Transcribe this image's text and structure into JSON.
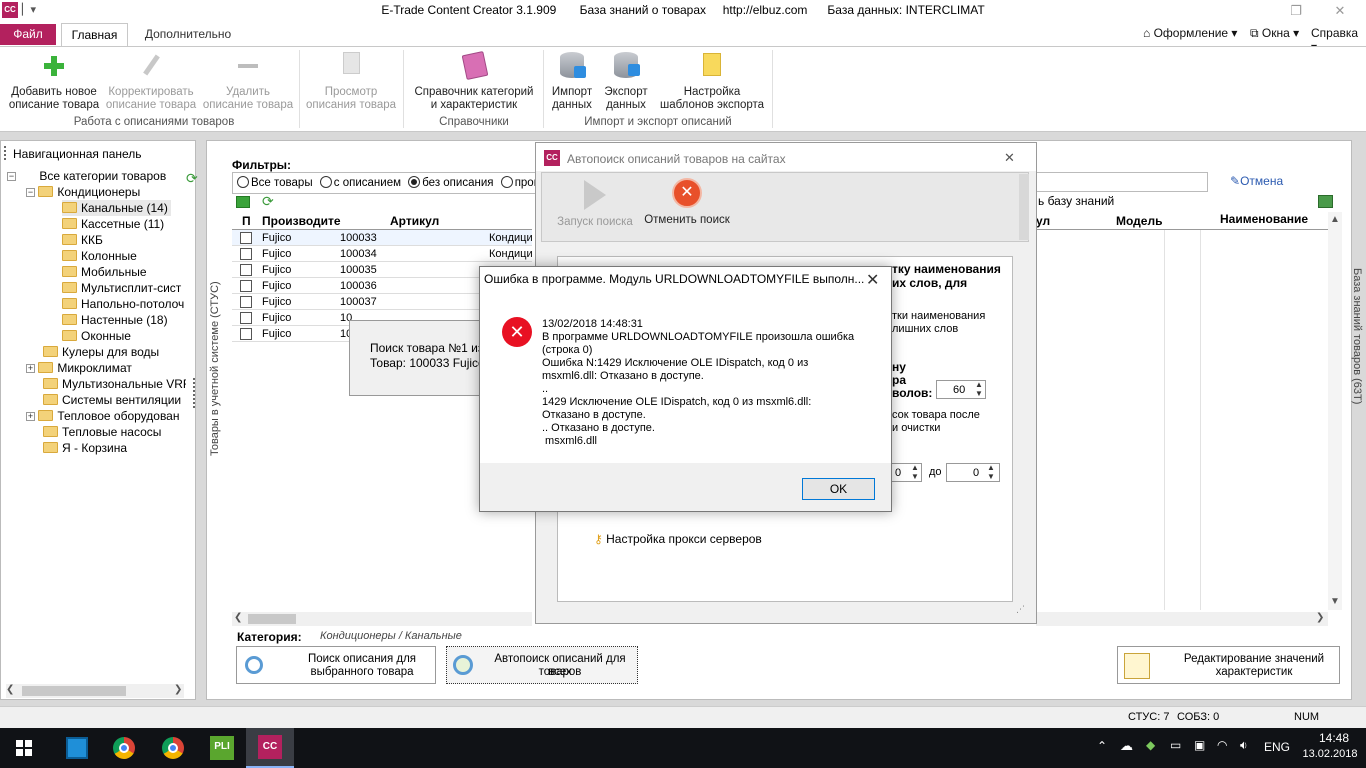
{
  "window": {
    "title": "E-Trade Content Creator 3.1.909       База знаний о товарах     http://elbuz.com      База данных: INTERCLIMAT",
    "app_icon": "CC"
  },
  "ribbon_tabs": {
    "file": "Файл",
    "main": "Главная",
    "extra": "Дополнительно"
  },
  "ribbon_right": {
    "design": "Оформление",
    "windows": "Окна",
    "help": "Справка"
  },
  "ribbon": {
    "add_label1": "Добавить новое",
    "add_label2": "описание товара",
    "edit_label1": "Корректировать",
    "edit_label2": "описание товара",
    "delete_label1": "Удалить",
    "delete_label2": "описание товара",
    "view_label1": "Просмотр",
    "view_label2": "описания товара",
    "group1": "Работа с описаниями товаров",
    "ref_label1": "Справочник категорий",
    "ref_label2": "и характеристик",
    "group2": "Справочники",
    "import_label1": "Импорт",
    "import_label2": "данных",
    "export_label1": "Экспорт",
    "export_label2": "данных",
    "templ_label1": "Настройка",
    "templ_label2": "шаблонов экспорта",
    "group3": "Импорт и экспорт описаний"
  },
  "nav": {
    "title": "Навигационная панель",
    "items": [
      {
        "label": "Все категории товаров"
      },
      {
        "label": "Кондиционеры"
      },
      {
        "label": "Канальные (14)"
      },
      {
        "label": "Кассетные (11)"
      },
      {
        "label": "ККБ"
      },
      {
        "label": "Колонные"
      },
      {
        "label": "Мобильные"
      },
      {
        "label": "Мультисплит-сист"
      },
      {
        "label": "Напольно-потолоч"
      },
      {
        "label": "Настенные (18)"
      },
      {
        "label": "Оконные"
      },
      {
        "label": "Кулеры для воды"
      },
      {
        "label": "Микроклимат"
      },
      {
        "label": "Мультизональные VRF"
      },
      {
        "label": "Системы вентиляции"
      },
      {
        "label": "Тепловое оборудован"
      },
      {
        "label": "Тепловые насосы"
      },
      {
        "label": "Я - Корзина"
      }
    ]
  },
  "left_vtab": "Товары в учетной системе (СТУС)",
  "right_vtab": "База знаний товаров (63Т)",
  "filters": {
    "title": "Фильтры:",
    "options": [
      "Все товары",
      "с описанием",
      "без описания",
      "прово"
    ],
    "selected": 2
  },
  "grid": {
    "headers": [
      "П",
      "Производите",
      "Артикул"
    ],
    "rows": [
      {
        "maker": "Fujico",
        "sku": "100033",
        "name": "Кондици"
      },
      {
        "maker": "Fujico",
        "sku": "100034",
        "name": "Кондици"
      },
      {
        "maker": "Fujico",
        "sku": "100035",
        "name": ""
      },
      {
        "maker": "Fujico",
        "sku": "100036",
        "name": ""
      },
      {
        "maker": "Fujico",
        "sku": "100037",
        "name": ""
      },
      {
        "maker": "Fujico",
        "sku": "10",
        "name": ""
      },
      {
        "maker": "Fujico",
        "sku": "10",
        "name": ""
      }
    ]
  },
  "search_popup": {
    "line1": "Поиск товара №1 из",
    "line2": "Товар: 100033 Fujico"
  },
  "category": {
    "label": "Категория:",
    "value": "Кондиционеры / Канальные"
  },
  "bottom_buttons": {
    "search1": "Поиск описания для",
    "search2": "выбранного товара",
    "auto1": "Автопоиск описаний для всех",
    "auto2": "товаров",
    "edit1": "Редактирование значений",
    "edit2": "характеристик"
  },
  "right_panel": {
    "cancel": "Отмена",
    "kb_text": "ь базу знаний",
    "headers": [
      "ул",
      "Модель",
      "Наименование"
    ]
  },
  "autosearch": {
    "title": "Автопоиск описаний товаров на сайтах",
    "start": "Запуск поиска",
    "cancel": "Отменить поиск",
    "frag1": "тку наименования",
    "frag2": "их слов, для",
    "frag3": "тки наименования",
    "frag4": "лишних слов",
    "frag5": "ну",
    "frag6": "ра",
    "frag7": "волов:",
    "spin1": "60",
    "frag8": "сок товара после",
    "frag9": "и очистки",
    "spin2": "0",
    "to": "до",
    "spin3": "0",
    "proxy": "Настройка прокси серверов"
  },
  "error": {
    "title": "Ошибка в программе. Модуль URLDOWNLOADTOMYFILE выполн...",
    "body": "13/02/2018 14:48:31\nВ программе URLDOWNLOADTOMYFILE произошла ошибка\n(строка 0)\nОшибка N:1429 Исключение OLE IDispatch, код 0 из\nmsxml6.dll: Отказано в доступе.\n..\n1429 Исключение OLE IDispatch, код 0 из msxml6.dll:\nОтказано в доступе.\n.. Отказано в доступе.\n msxml6.dll",
    "ok": "OK"
  },
  "status": {
    "stus": "СТУС: 7",
    "sobz": "СОБЗ: 0",
    "num": "NUM"
  },
  "taskbar": {
    "time": "14:48",
    "date": "13.02.2018",
    "lang": "ENG"
  }
}
